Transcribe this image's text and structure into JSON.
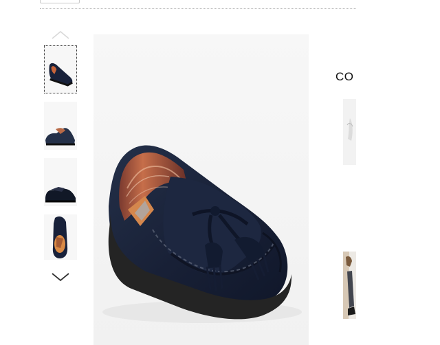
{
  "gallery": {
    "thumbnails": [
      {
        "icon": "shoe-angle-thumbnail",
        "selected": true
      },
      {
        "icon": "shoe-side-thumbnail",
        "selected": false
      },
      {
        "icon": "shoe-profile-thumbnail",
        "selected": false
      },
      {
        "icon": "shoe-top-thumbnail",
        "selected": false
      }
    ],
    "scroll_up_icon": "chevron-up-icon",
    "scroll_down_icon": "chevron-down-icon"
  },
  "main_image": {
    "icon": "navy-suede-tassel-loafer"
  },
  "side_panel": {
    "heading": "CO"
  },
  "colors": {
    "shoe_navy": "#18213a",
    "sole": "#222222",
    "lining_orange": "#c8643a"
  }
}
